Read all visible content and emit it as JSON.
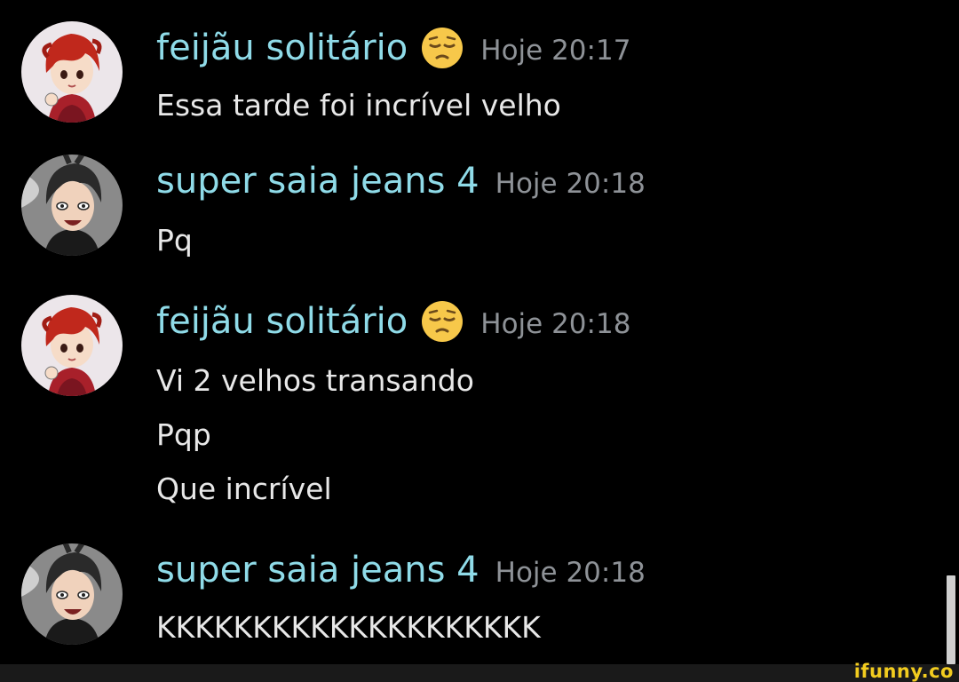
{
  "messages": [
    {
      "username": "feijãu solitário",
      "timestamp": "Hoje 20:17",
      "avatar_icon": "red-hair-anime-avatar-icon",
      "emoji_icon": "pensive-face-emoji-icon",
      "lines": [
        "Essa tarde foi incrível velho"
      ]
    },
    {
      "username": "super saia jeans 4",
      "timestamp": "Hoje 20:18",
      "avatar_icon": "dark-hair-anime-avatar-icon",
      "lines": [
        "Pq"
      ]
    },
    {
      "username": "feijãu solitário",
      "timestamp": "Hoje 20:18",
      "avatar_icon": "red-hair-anime-avatar-icon",
      "emoji_icon": "pensive-face-emoji-icon",
      "lines": [
        "Vi 2 velhos transando",
        "Pqp",
        "Que incrível"
      ]
    },
    {
      "username": "super saia jeans 4",
      "timestamp": "Hoje 20:18",
      "avatar_icon": "dark-hair-anime-avatar-icon",
      "lines": [
        "KKKKKKKKKKKKKKKKKKKK"
      ]
    }
  ],
  "watermark": "ifunny.co",
  "colors": {
    "background": "#000000",
    "username": "#8fdbe8",
    "timestamp": "#8e9297",
    "message_text": "#e8e8e8",
    "watermark": "#f2cc1f"
  }
}
